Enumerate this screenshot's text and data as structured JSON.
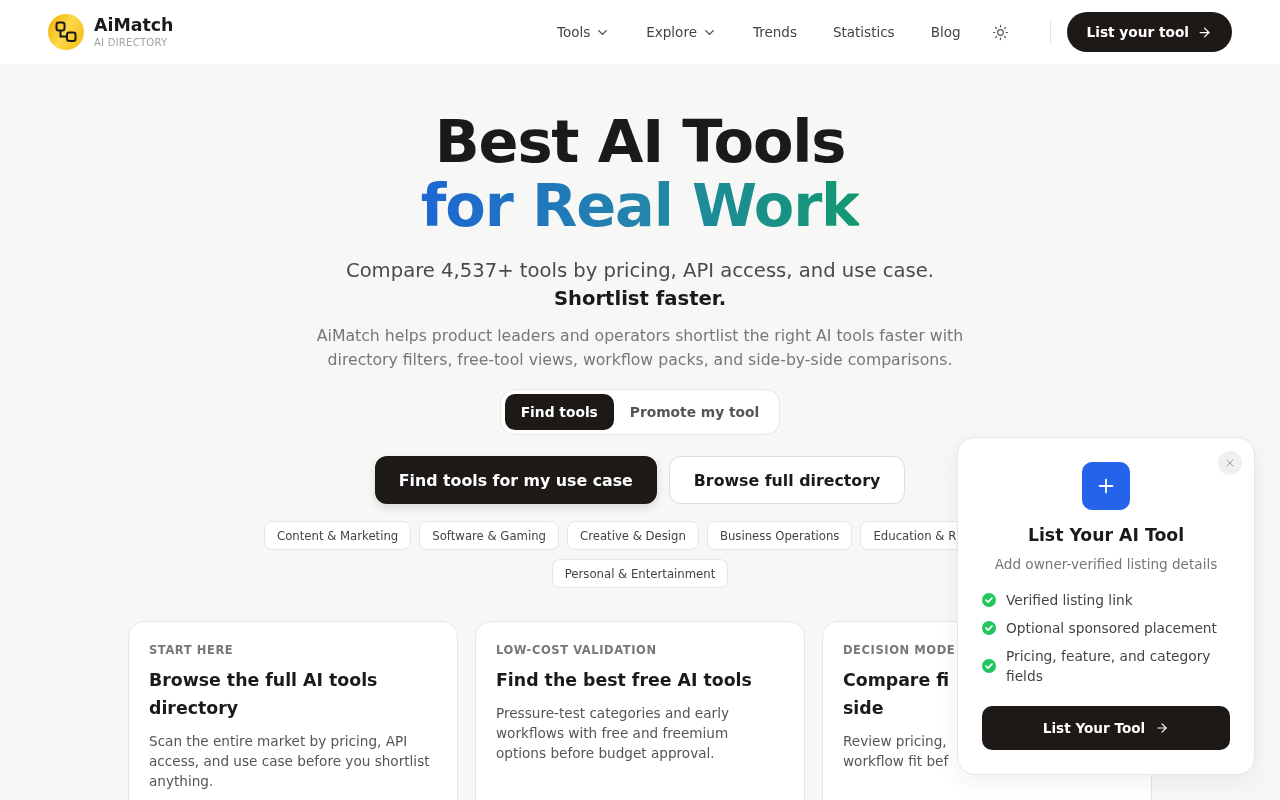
{
  "header": {
    "brand": {
      "name": "AiMatch",
      "tagline": "AI DIRECTORY"
    },
    "nav": [
      {
        "label": "Tools",
        "kind": "dropdown"
      },
      {
        "label": "Explore",
        "kind": "dropdown"
      },
      {
        "label": "Trends",
        "kind": "link"
      },
      {
        "label": "Statistics",
        "kind": "link"
      },
      {
        "label": "Blog",
        "kind": "link"
      }
    ],
    "cta": "List your tool"
  },
  "hero": {
    "title_line_1": "Best AI Tools",
    "title_line_2": "for Real Work",
    "lead": "Compare 4,537+ tools by pricing, API access, and use case.",
    "lead_emphasis": "Shortlist faster.",
    "description": "AiMatch helps product leaders and operators shortlist the right AI tools faster with directory filters, free-tool views, workflow packs, and side-by-side comparisons.",
    "mode_tabs": [
      {
        "label": "Find tools",
        "selected": true
      },
      {
        "label": "Promote my tool",
        "selected": false
      }
    ],
    "actions": [
      {
        "label": "Find tools for my use case",
        "kind": "primary"
      },
      {
        "label": "Browse full directory",
        "kind": "secondary"
      }
    ],
    "categories": [
      "Content & Marketing",
      "Software & Gaming",
      "Creative & Design",
      "Business Operations",
      "Education & R",
      "Personal & Entertainment"
    ]
  },
  "cards": [
    {
      "eyebrow": "START HERE",
      "title": "Browse the full AI tools directory",
      "description": "Scan the entire market by pricing, API access, and use case before you shortlist anything."
    },
    {
      "eyebrow": "LOW-COST VALIDATION",
      "title": "Find the best free AI tools",
      "description": "Pressure-test categories and early workflows with free and freemium options before budget approval."
    },
    {
      "eyebrow": "DECISION MODE",
      "title": "Compare fi\nside",
      "description": "Review pricing,\nworkflow fit bef"
    }
  ],
  "popup": {
    "title": "List Your AI Tool",
    "subtitle": "Add owner-verified listing details",
    "features": [
      "Verified listing link",
      "Optional sponsored placement",
      "Pricing, feature, and category fields"
    ],
    "button": "List Your Tool"
  }
}
